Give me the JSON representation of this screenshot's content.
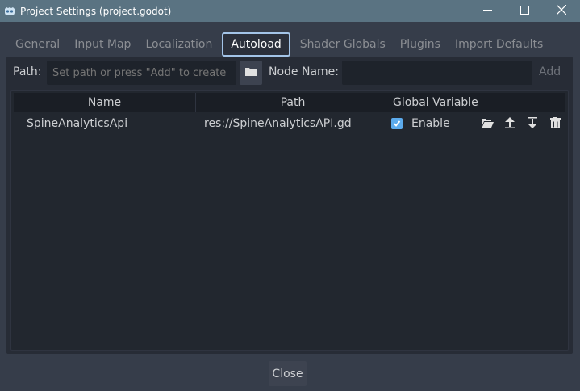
{
  "window": {
    "title": "Project Settings (project.godot)",
    "icon": "godot-icon",
    "controls": [
      "minimize-icon",
      "maximize-icon",
      "close-icon"
    ]
  },
  "tabs": [
    {
      "label": "General",
      "active": false
    },
    {
      "label": "Input Map",
      "active": false
    },
    {
      "label": "Localization",
      "active": false
    },
    {
      "label": "Autoload",
      "active": true
    },
    {
      "label": "Shader Globals",
      "active": false
    },
    {
      "label": "Plugins",
      "active": false
    },
    {
      "label": "Import Defaults",
      "active": false
    }
  ],
  "autoload": {
    "path_label": "Path:",
    "path_placeholder": "Set path or press \"Add\" to create",
    "node_name_label": "Node Name:",
    "node_name_value": "",
    "add_label": "Add",
    "columns": [
      "Name",
      "Path",
      "Global Variable"
    ],
    "rows": [
      {
        "name": "SpineAnalyticsApi",
        "path": "res://SpineAnalyticsAPI.gd",
        "enabled": true,
        "enable_label": "Enable",
        "actions": [
          "open-folder-icon",
          "move-up-icon",
          "move-down-icon",
          "delete-icon"
        ]
      }
    ]
  },
  "footer": {
    "close_label": "Close"
  },
  "colors": {
    "titlebar": "#5a7382",
    "background": "#363d4a",
    "panel": "#272c36",
    "accent": "#5cabed",
    "active_tab_border": "#a3c4e8"
  }
}
